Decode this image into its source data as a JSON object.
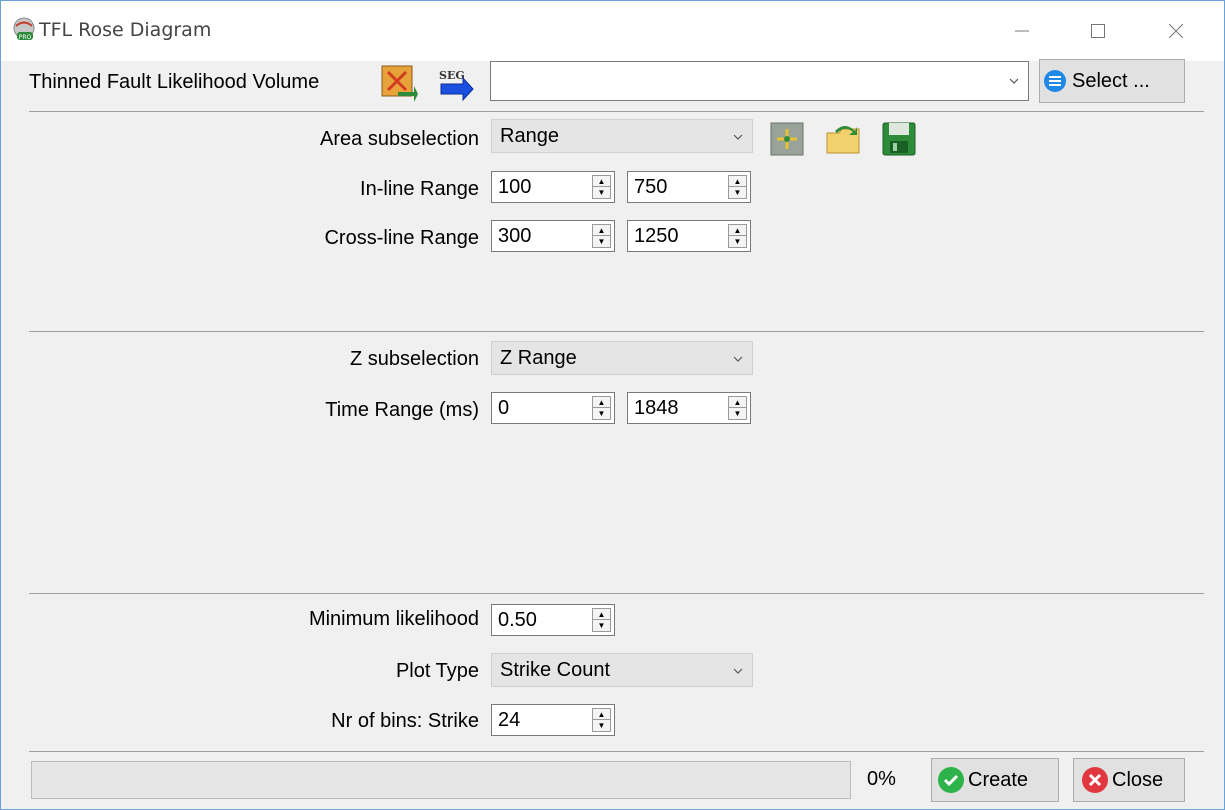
{
  "window": {
    "title": "TFL Rose Diagram"
  },
  "input": {
    "label": "Thinned Fault Likelihood Volume",
    "value": "",
    "select_label": "Select ..."
  },
  "area": {
    "subselection_label": "Area subselection",
    "subselection_value": "Range",
    "inline_label": "In-line Range",
    "inline_from": "100",
    "inline_to": "750",
    "crossline_label": "Cross-line Range",
    "crossline_from": "300",
    "crossline_to": "1250"
  },
  "z": {
    "subselection_label": "Z subselection",
    "subselection_value": "Z Range",
    "time_label": "Time Range (ms)",
    "time_from": "0",
    "time_to": "1848"
  },
  "params": {
    "min_likelihood_label": "Minimum likelihood",
    "min_likelihood_value": "0.50",
    "plot_type_label": "Plot Type",
    "plot_type_value": "Strike Count",
    "nbins_label": "Nr of bins: Strike",
    "nbins_value": "24"
  },
  "footer": {
    "progress_text": "0%",
    "progress_value": 0,
    "create_label": "Create",
    "close_label": "Close"
  },
  "colors": {
    "accent": "#1e88e5",
    "create_green": "#2db34a",
    "close_red": "#e0383e"
  }
}
